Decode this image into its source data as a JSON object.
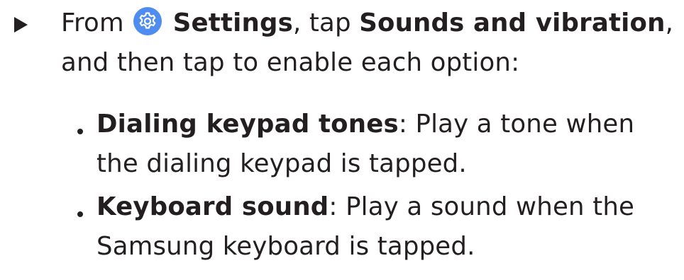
{
  "step": {
    "prefix": "From",
    "app_name": "Settings",
    "middle": ", tap",
    "menu_name": "Sounds and vibration",
    "suffix": ", and then tap to enable each option:",
    "icon": "settings-gear-icon",
    "icon_color": "#4f8cf0"
  },
  "options": [
    {
      "title": "Dialing keypad tones",
      "description": ": Play a tone when the dialing keypad is tapped."
    },
    {
      "title": "Keyboard sound",
      "description": ": Play a sound when the Samsung keyboard is tapped."
    }
  ]
}
